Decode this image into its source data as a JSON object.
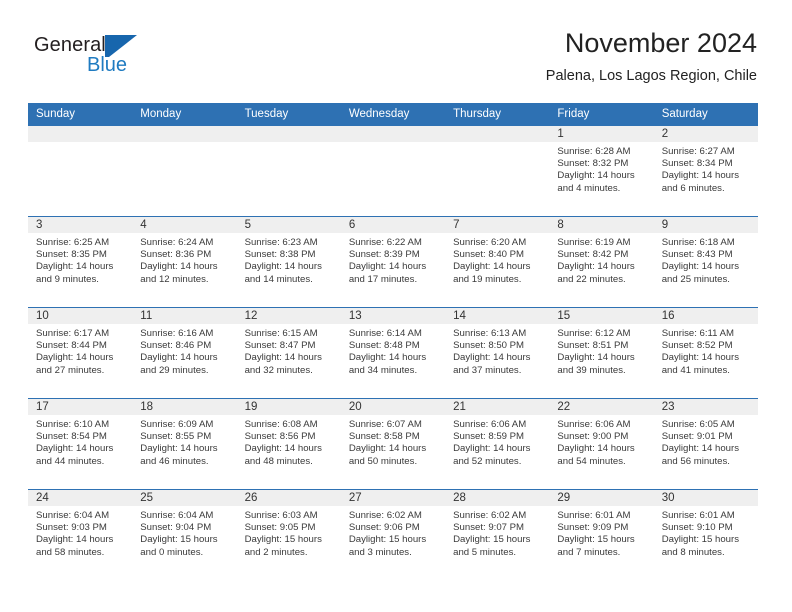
{
  "brand": {
    "name_part1": "General",
    "name_part2": "Blue",
    "flag_icon": "triangle-flag-icon",
    "accent_color": "#1766ad"
  },
  "header": {
    "title": "November 2024",
    "subtitle": "Palena, Los Lagos Region, Chile"
  },
  "theme": {
    "header_blue": "#2e71b3",
    "daynum_band_gray": "#efefef",
    "text_color": "#3a3a3a"
  },
  "weekday_headers": [
    "Sunday",
    "Monday",
    "Tuesday",
    "Wednesday",
    "Thursday",
    "Friday",
    "Saturday"
  ],
  "labels": {
    "sunrise_prefix": "Sunrise:",
    "sunset_prefix": "Sunset:",
    "daylight_prefix": "Daylight:"
  },
  "weeks": [
    [
      {
        "day": "",
        "sunrise": "",
        "sunset": "",
        "daylight_line1": "",
        "daylight_line2": ""
      },
      {
        "day": "",
        "sunrise": "",
        "sunset": "",
        "daylight_line1": "",
        "daylight_line2": ""
      },
      {
        "day": "",
        "sunrise": "",
        "sunset": "",
        "daylight_line1": "",
        "daylight_line2": ""
      },
      {
        "day": "",
        "sunrise": "",
        "sunset": "",
        "daylight_line1": "",
        "daylight_line2": ""
      },
      {
        "day": "",
        "sunrise": "",
        "sunset": "",
        "daylight_line1": "",
        "daylight_line2": ""
      },
      {
        "day": "1",
        "sunrise": "Sunrise: 6:28 AM",
        "sunset": "Sunset: 8:32 PM",
        "daylight_line1": "Daylight: 14 hours",
        "daylight_line2": "and 4 minutes."
      },
      {
        "day": "2",
        "sunrise": "Sunrise: 6:27 AM",
        "sunset": "Sunset: 8:34 PM",
        "daylight_line1": "Daylight: 14 hours",
        "daylight_line2": "and 6 minutes."
      }
    ],
    [
      {
        "day": "3",
        "sunrise": "Sunrise: 6:25 AM",
        "sunset": "Sunset: 8:35 PM",
        "daylight_line1": "Daylight: 14 hours",
        "daylight_line2": "and 9 minutes."
      },
      {
        "day": "4",
        "sunrise": "Sunrise: 6:24 AM",
        "sunset": "Sunset: 8:36 PM",
        "daylight_line1": "Daylight: 14 hours",
        "daylight_line2": "and 12 minutes."
      },
      {
        "day": "5",
        "sunrise": "Sunrise: 6:23 AM",
        "sunset": "Sunset: 8:38 PM",
        "daylight_line1": "Daylight: 14 hours",
        "daylight_line2": "and 14 minutes."
      },
      {
        "day": "6",
        "sunrise": "Sunrise: 6:22 AM",
        "sunset": "Sunset: 8:39 PM",
        "daylight_line1": "Daylight: 14 hours",
        "daylight_line2": "and 17 minutes."
      },
      {
        "day": "7",
        "sunrise": "Sunrise: 6:20 AM",
        "sunset": "Sunset: 8:40 PM",
        "daylight_line1": "Daylight: 14 hours",
        "daylight_line2": "and 19 minutes."
      },
      {
        "day": "8",
        "sunrise": "Sunrise: 6:19 AM",
        "sunset": "Sunset: 8:42 PM",
        "daylight_line1": "Daylight: 14 hours",
        "daylight_line2": "and 22 minutes."
      },
      {
        "day": "9",
        "sunrise": "Sunrise: 6:18 AM",
        "sunset": "Sunset: 8:43 PM",
        "daylight_line1": "Daylight: 14 hours",
        "daylight_line2": "and 25 minutes."
      }
    ],
    [
      {
        "day": "10",
        "sunrise": "Sunrise: 6:17 AM",
        "sunset": "Sunset: 8:44 PM",
        "daylight_line1": "Daylight: 14 hours",
        "daylight_line2": "and 27 minutes."
      },
      {
        "day": "11",
        "sunrise": "Sunrise: 6:16 AM",
        "sunset": "Sunset: 8:46 PM",
        "daylight_line1": "Daylight: 14 hours",
        "daylight_line2": "and 29 minutes."
      },
      {
        "day": "12",
        "sunrise": "Sunrise: 6:15 AM",
        "sunset": "Sunset: 8:47 PM",
        "daylight_line1": "Daylight: 14 hours",
        "daylight_line2": "and 32 minutes."
      },
      {
        "day": "13",
        "sunrise": "Sunrise: 6:14 AM",
        "sunset": "Sunset: 8:48 PM",
        "daylight_line1": "Daylight: 14 hours",
        "daylight_line2": "and 34 minutes."
      },
      {
        "day": "14",
        "sunrise": "Sunrise: 6:13 AM",
        "sunset": "Sunset: 8:50 PM",
        "daylight_line1": "Daylight: 14 hours",
        "daylight_line2": "and 37 minutes."
      },
      {
        "day": "15",
        "sunrise": "Sunrise: 6:12 AM",
        "sunset": "Sunset: 8:51 PM",
        "daylight_line1": "Daylight: 14 hours",
        "daylight_line2": "and 39 minutes."
      },
      {
        "day": "16",
        "sunrise": "Sunrise: 6:11 AM",
        "sunset": "Sunset: 8:52 PM",
        "daylight_line1": "Daylight: 14 hours",
        "daylight_line2": "and 41 minutes."
      }
    ],
    [
      {
        "day": "17",
        "sunrise": "Sunrise: 6:10 AM",
        "sunset": "Sunset: 8:54 PM",
        "daylight_line1": "Daylight: 14 hours",
        "daylight_line2": "and 44 minutes."
      },
      {
        "day": "18",
        "sunrise": "Sunrise: 6:09 AM",
        "sunset": "Sunset: 8:55 PM",
        "daylight_line1": "Daylight: 14 hours",
        "daylight_line2": "and 46 minutes."
      },
      {
        "day": "19",
        "sunrise": "Sunrise: 6:08 AM",
        "sunset": "Sunset: 8:56 PM",
        "daylight_line1": "Daylight: 14 hours",
        "daylight_line2": "and 48 minutes."
      },
      {
        "day": "20",
        "sunrise": "Sunrise: 6:07 AM",
        "sunset": "Sunset: 8:58 PM",
        "daylight_line1": "Daylight: 14 hours",
        "daylight_line2": "and 50 minutes."
      },
      {
        "day": "21",
        "sunrise": "Sunrise: 6:06 AM",
        "sunset": "Sunset: 8:59 PM",
        "daylight_line1": "Daylight: 14 hours",
        "daylight_line2": "and 52 minutes."
      },
      {
        "day": "22",
        "sunrise": "Sunrise: 6:06 AM",
        "sunset": "Sunset: 9:00 PM",
        "daylight_line1": "Daylight: 14 hours",
        "daylight_line2": "and 54 minutes."
      },
      {
        "day": "23",
        "sunrise": "Sunrise: 6:05 AM",
        "sunset": "Sunset: 9:01 PM",
        "daylight_line1": "Daylight: 14 hours",
        "daylight_line2": "and 56 minutes."
      }
    ],
    [
      {
        "day": "24",
        "sunrise": "Sunrise: 6:04 AM",
        "sunset": "Sunset: 9:03 PM",
        "daylight_line1": "Daylight: 14 hours",
        "daylight_line2": "and 58 minutes."
      },
      {
        "day": "25",
        "sunrise": "Sunrise: 6:04 AM",
        "sunset": "Sunset: 9:04 PM",
        "daylight_line1": "Daylight: 15 hours",
        "daylight_line2": "and 0 minutes."
      },
      {
        "day": "26",
        "sunrise": "Sunrise: 6:03 AM",
        "sunset": "Sunset: 9:05 PM",
        "daylight_line1": "Daylight: 15 hours",
        "daylight_line2": "and 2 minutes."
      },
      {
        "day": "27",
        "sunrise": "Sunrise: 6:02 AM",
        "sunset": "Sunset: 9:06 PM",
        "daylight_line1": "Daylight: 15 hours",
        "daylight_line2": "and 3 minutes."
      },
      {
        "day": "28",
        "sunrise": "Sunrise: 6:02 AM",
        "sunset": "Sunset: 9:07 PM",
        "daylight_line1": "Daylight: 15 hours",
        "daylight_line2": "and 5 minutes."
      },
      {
        "day": "29",
        "sunrise": "Sunrise: 6:01 AM",
        "sunset": "Sunset: 9:09 PM",
        "daylight_line1": "Daylight: 15 hours",
        "daylight_line2": "and 7 minutes."
      },
      {
        "day": "30",
        "sunrise": "Sunrise: 6:01 AM",
        "sunset": "Sunset: 9:10 PM",
        "daylight_line1": "Daylight: 15 hours",
        "daylight_line2": "and 8 minutes."
      }
    ]
  ]
}
